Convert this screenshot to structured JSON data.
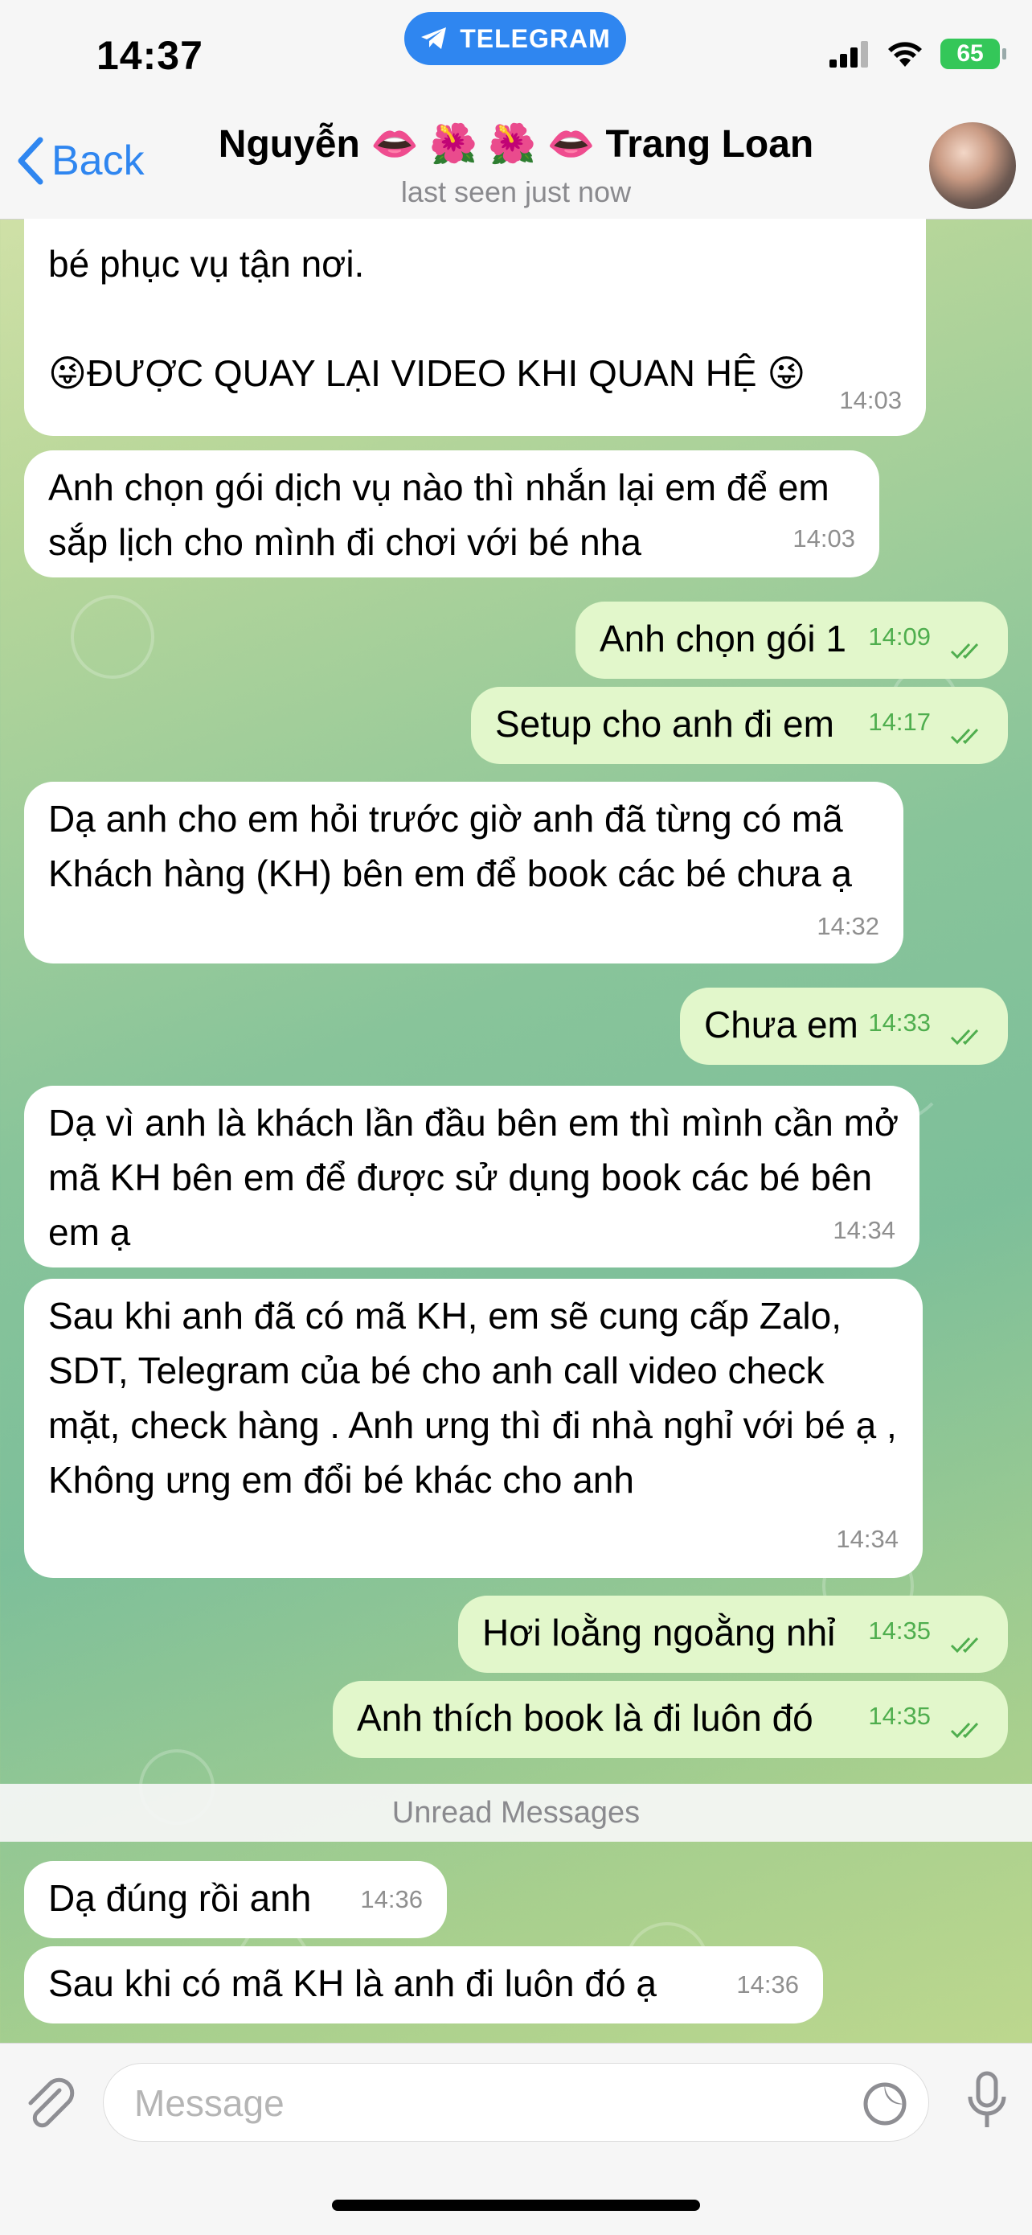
{
  "status_bar": {
    "time": "14:37",
    "pill": "TELEGRAM",
    "battery": "65"
  },
  "header": {
    "back": "Back",
    "title": "Nguyễn 👄 🌺 🌺 👄 Trang Loan",
    "subtitle": "last seen just now"
  },
  "messages": [
    {
      "dir": "in",
      "text": "bé phục vụ tận nơi.",
      "time": ""
    },
    {
      "dir": "in",
      "text": "😜ĐƯỢC QUAY LẠI VIDEO KHI QUAN HỆ 😜",
      "time": "14:03"
    },
    {
      "dir": "in",
      "text": "Anh chọn gói dịch vụ nào thì nhắn lại em để em sắp lịch cho mình đi chơi với bé nha",
      "time": "14:03"
    },
    {
      "dir": "out",
      "text": "Anh chọn gói 1",
      "time": "14:09"
    },
    {
      "dir": "out",
      "text": "Setup cho anh đi em",
      "time": "14:17"
    },
    {
      "dir": "in",
      "text": "Dạ anh cho em hỏi trước giờ anh đã từng có mã Khách hàng (KH) bên em để book các bé chưa ạ",
      "time": "14:32"
    },
    {
      "dir": "out",
      "text": "Chưa em",
      "time": "14:33"
    },
    {
      "dir": "in",
      "text": "Dạ vì anh là khách lần đầu bên em thì mình cần mở mã KH bên em để được sử dụng book các bé bên em ạ",
      "time": "14:34"
    },
    {
      "dir": "in",
      "text": "Sau khi anh đã có mã KH, em sẽ cung cấp Zalo, SDT, Telegram của bé cho anh call video check mặt, check hàng . Anh ưng thì đi nhà nghỉ với bé ạ , Không ưng em đổi bé khác cho anh",
      "time": "14:34"
    },
    {
      "dir": "out",
      "text": "Hơi loằng ngoằng nhỉ",
      "time": "14:35"
    },
    {
      "dir": "out",
      "text": "Anh thích book là đi luôn đó",
      "time": "14:35"
    },
    {
      "dir": "in",
      "text": "Dạ đúng rồi anh",
      "time": "14:36"
    },
    {
      "dir": "in",
      "text": "Sau khi có mã KH là anh đi luôn đó ạ",
      "time": "14:36"
    }
  ],
  "unread_label": "Unread Messages",
  "input": {
    "placeholder": "Message"
  },
  "colors": {
    "accent": "#2f86f0",
    "outgoing_bubble": "#e2f7cb",
    "incoming_bubble": "#ffffff",
    "read_ticks": "#4fae4e"
  },
  "icons": [
    "telegram-icon",
    "signal-icon",
    "wifi-icon",
    "battery-icon",
    "chevron-left-icon",
    "paperclip-icon",
    "sticker-icon",
    "microphone-icon",
    "double-check-icon"
  ]
}
